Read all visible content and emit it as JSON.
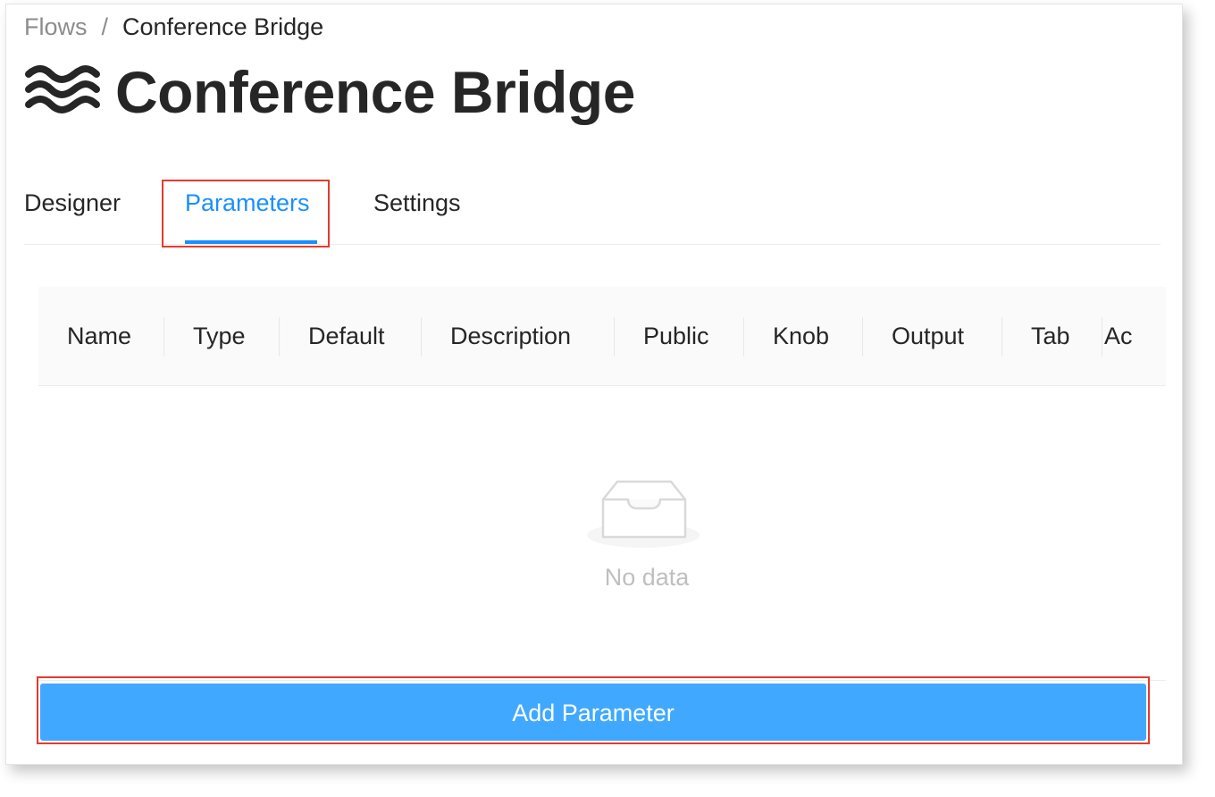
{
  "breadcrumb": {
    "root": "Flows",
    "separator": "/",
    "current": "Conference Bridge"
  },
  "page": {
    "title": "Conference Bridge",
    "icon": "waves-icon"
  },
  "tabs": [
    {
      "label": "Designer",
      "active": false
    },
    {
      "label": "Parameters",
      "active": true
    },
    {
      "label": "Settings",
      "active": false
    }
  ],
  "table": {
    "columns": [
      "Name",
      "Type",
      "Default",
      "Description",
      "Public",
      "Knob",
      "Output",
      "Tab",
      "Ac"
    ],
    "rows": [],
    "empty_text": "No data",
    "empty_icon": "inbox-icon"
  },
  "actions": {
    "add_parameter_label": "Add Parameter"
  },
  "colors": {
    "accent": "#1890ff",
    "button": "#40a9ff",
    "highlight": "#e53a2f",
    "text": "#262626",
    "muted": "#8c8c8c"
  }
}
